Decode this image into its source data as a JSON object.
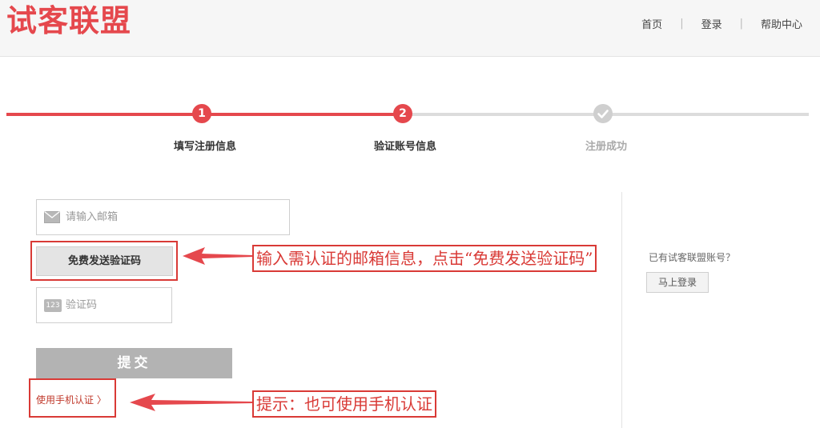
{
  "header": {
    "logo": "试客联盟",
    "nav": [
      "首页",
      "登录",
      "帮助中心"
    ],
    "separator": "|"
  },
  "steps": [
    {
      "number": "1",
      "label": "填写注册信息",
      "state": "done"
    },
    {
      "number": "2",
      "label": "验证账号信息",
      "state": "current"
    },
    {
      "number": "",
      "label": "注册成功",
      "state": "pending"
    }
  ],
  "form": {
    "email_placeholder": "请输入邮箱",
    "send_code_label": "免费发送验证码",
    "code_icon_text": "123",
    "code_placeholder": "验证码",
    "submit_label": "提交",
    "phone_link_label": "使用手机认证 〉"
  },
  "side": {
    "has_account_text": "已有试客联盟账号？",
    "login_now_label": "马上登录"
  },
  "annotations": {
    "send_tip": "输入需认证的邮箱信息，点击“免费发送验证码”",
    "phone_tip": "提示：也可使用手机认证"
  },
  "colors": {
    "brand": "#e5484d",
    "annotation": "#d93a36",
    "pending": "#cfcfcf"
  },
  "icons": {
    "email": "envelope-icon",
    "code": "code-123-icon",
    "step_done": "check-icon"
  }
}
